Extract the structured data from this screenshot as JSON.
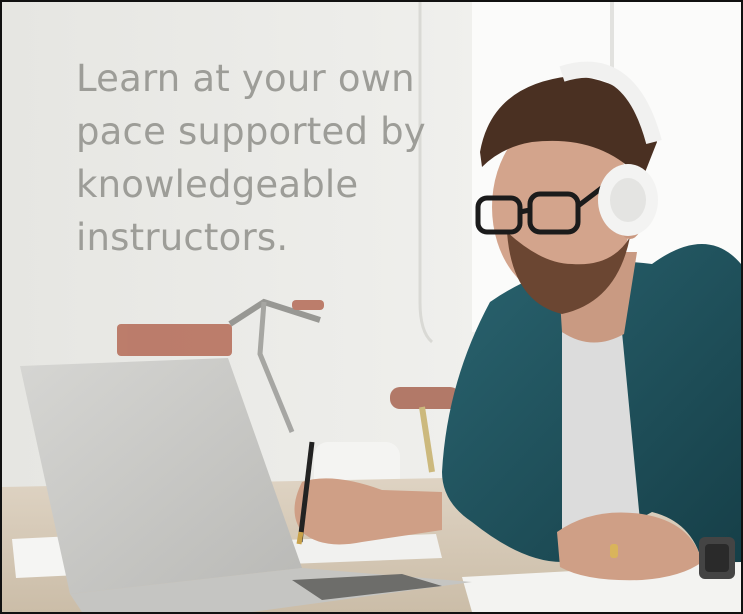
{
  "headline": {
    "lines": [
      "Learn at your own",
      "pace supported by",
      "knowledgeable",
      "instructors."
    ]
  },
  "photo": {
    "subject": "man-with-headphones-writing-at-laptop",
    "colors": {
      "background": "#ebebe8",
      "shirt": "#1f5560",
      "headphones": "#f2f2f2",
      "laptop": "#c9c9c6",
      "desk": "#d8cbb8"
    }
  }
}
